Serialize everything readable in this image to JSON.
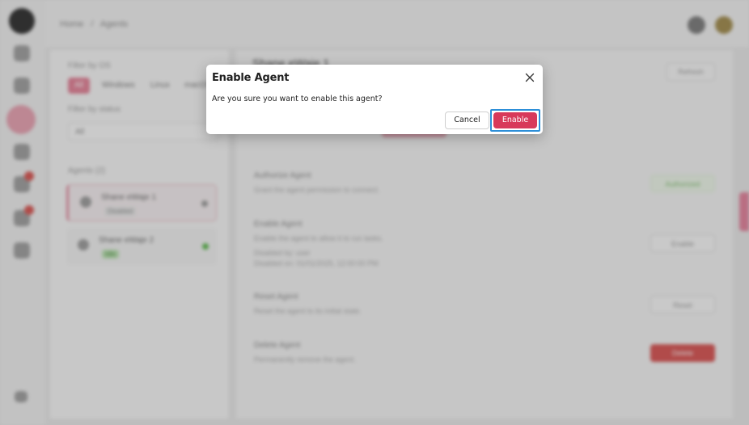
{
  "background": {
    "breadcrumb": [
      "Home",
      "/",
      "Agents"
    ],
    "filter_os_label": "Filter by OS",
    "os_tabs": [
      "All",
      "Windows",
      "Linux",
      "macOS"
    ],
    "filter_status_label": "Filter by status",
    "status_value": "All",
    "agents_label": "Agents (2)",
    "agents": [
      {
        "name": "Shane eWaje 1",
        "state": "Disabled"
      },
      {
        "name": "Shane eWaje 2",
        "state": "Idle"
      }
    ],
    "main_title": "Shane eWaje 1",
    "refresh_label": "Refresh",
    "rows": [
      {
        "title": "Authorize Agent",
        "desc": "Grant the agent permission to connect.",
        "button": "Authorized"
      },
      {
        "title": "Enable Agent",
        "desc": "Enable the agent to allow it to run tasks.",
        "extra1": "Disabled by: user",
        "extra2": "Disabled on: 01/01/2025, 12:00:00 PM",
        "button": "Enable"
      },
      {
        "title": "Reset Agent",
        "desc": "Reset the agent to its initial state.",
        "button": "Reset"
      },
      {
        "title": "Delete Agent",
        "desc": "Permanently remove the agent.",
        "button": "Delete"
      }
    ]
  },
  "dialog": {
    "title": "Enable Agent",
    "message": "Are you sure you want to enable this agent?",
    "cancel_label": "Cancel",
    "confirm_label": "Enable",
    "close_icon": "close-icon"
  },
  "colors": {
    "accent": "#d8395a",
    "focus_ring": "#2d8fd8"
  }
}
